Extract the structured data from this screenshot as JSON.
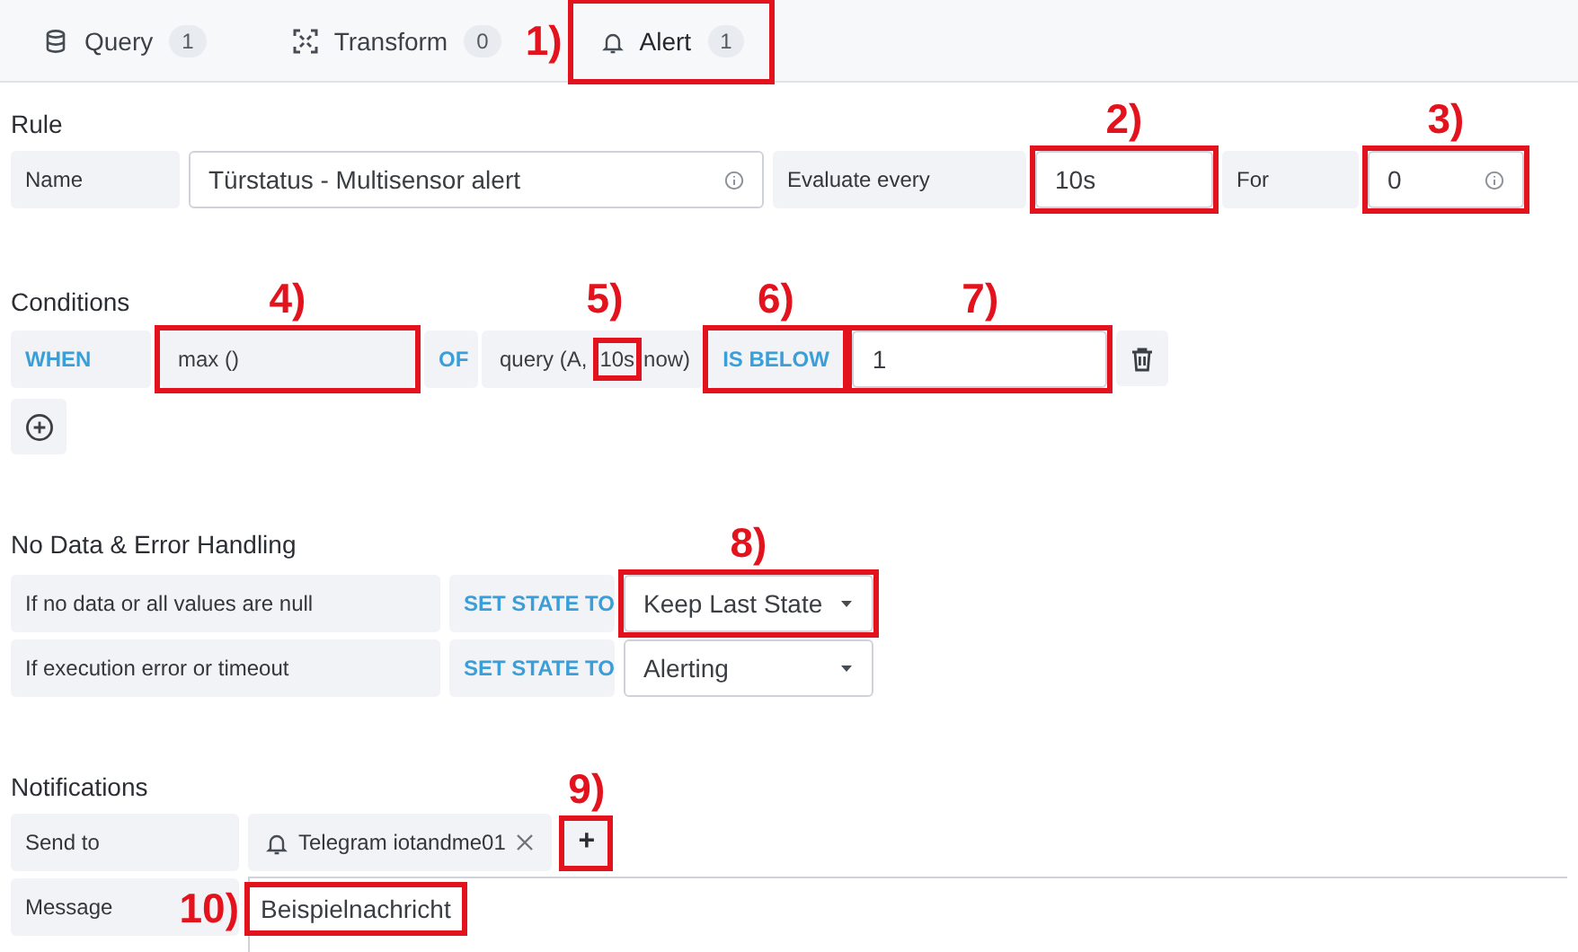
{
  "tabs": [
    {
      "label": "Query",
      "count": "1",
      "selected": false
    },
    {
      "label": "Transform",
      "count": "0",
      "selected": false
    },
    {
      "label": "Alert",
      "count": "1",
      "selected": true,
      "callout": {
        "label": "1)",
        "kind": "left"
      }
    }
  ],
  "rule": {
    "title": "Rule",
    "fields": [
      {
        "label": "Name",
        "value": "Türstatus - Multisensor alert",
        "info": true
      },
      {
        "label": "Evaluate every",
        "value": "10s",
        "info": false,
        "callout": {
          "label": "2)",
          "kind": "above"
        }
      },
      {
        "label": "For",
        "value": "0",
        "info": true,
        "callout": {
          "label": "3)",
          "kind": "above"
        }
      }
    ]
  },
  "conditions": {
    "title": "Conditions",
    "rows": [
      {
        "when": "WHEN",
        "reducer": "max ()",
        "reducer_callout": {
          "label": "4)",
          "kind": "above"
        },
        "of": "OF",
        "query_parts": [
          "query (A,",
          "10s",
          "now)"
        ],
        "query_callout": {
          "label": "5)",
          "kind": "above"
        },
        "evaluator": "IS BELOW",
        "evaluator_callout": {
          "label": "6)",
          "kind": "above"
        },
        "threshold": "1",
        "threshold_callout": {
          "label": "7)",
          "kind": "above"
        }
      }
    ]
  },
  "no_data": {
    "title": "No Data & Error Handling",
    "rows": [
      {
        "label": "If no data or all values are null",
        "action": "SET STATE TO",
        "value": "Keep Last State",
        "callout": {
          "label": "8)",
          "kind": "above"
        }
      },
      {
        "label": "If execution error or timeout",
        "action": "SET STATE TO",
        "value": "Alerting"
      }
    ]
  },
  "notifications": {
    "title": "Notifications",
    "send_to_label": "Send to",
    "channels": [
      {
        "name": "Telegram iotandme01"
      }
    ],
    "add_label": "+",
    "add_callout": {
      "label": "9)",
      "kind": "above"
    },
    "message_label": "Message",
    "message": "Beispielnachricht",
    "message_callout": {
      "label": "10)",
      "kind": "left"
    }
  }
}
